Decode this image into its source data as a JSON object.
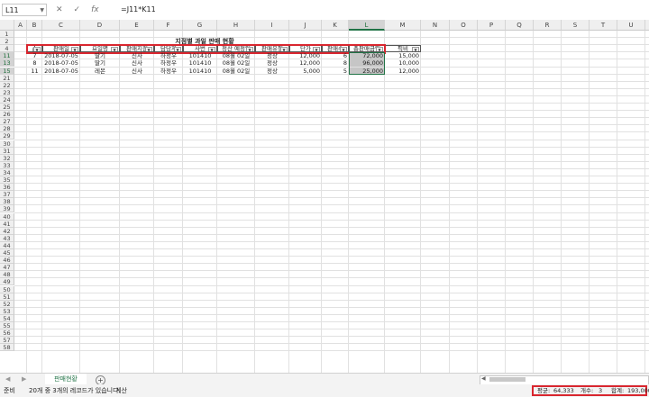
{
  "formula_bar": {
    "name_box": "L11",
    "formula": "=J11*K11",
    "cancel_icon": "✕",
    "enter_icon": "✓",
    "fx_icon": "fx"
  },
  "columns": [
    "A",
    "B",
    "C",
    "D",
    "E",
    "F",
    "G",
    "H",
    "I",
    "J",
    "K",
    "L",
    "M",
    "N",
    "O",
    "P",
    "Q",
    "R",
    "S",
    "T",
    "U",
    "V"
  ],
  "selected_column": "L",
  "rows": [
    "1",
    "2",
    "4",
    "11",
    "13",
    "15",
    "21",
    "22",
    "23",
    "24",
    "25",
    "26",
    "27",
    "28",
    "29",
    "30",
    "31",
    "32",
    "33",
    "34",
    "35",
    "36",
    "37",
    "38",
    "39",
    "40",
    "41",
    "42",
    "43",
    "44",
    "45",
    "46",
    "47",
    "48",
    "49",
    "50",
    "51",
    "52",
    "53",
    "54",
    "55",
    "56",
    "57",
    "58"
  ],
  "highlighted_rows": [
    "11",
    "13",
    "15"
  ],
  "sheet": {
    "title": "지점별 과일 판매 현황",
    "headers": [
      "순",
      "판매일",
      "요일명",
      "판매지점",
      "담당자",
      "사번",
      "정산 예정일",
      "판매유형",
      "단가",
      "판매수",
      "총판매금액",
      "픽비"
    ],
    "data_rows": [
      [
        "7",
        "2018-07-05",
        "딸기",
        "신사",
        "하정우",
        "101410",
        "08월 02일",
        "정상",
        "12,000",
        "6",
        "72,000",
        "15,000"
      ],
      [
        "8",
        "2018-07-05",
        "딸기",
        "신사",
        "하정우",
        "101410",
        "08월 02일",
        "정상",
        "12,000",
        "8",
        "96,000",
        "10,000"
      ],
      [
        "11",
        "2018-07-05",
        "레몬",
        "신사",
        "하정우",
        "101410",
        "08월 02일",
        "정상",
        "5,000",
        "5",
        "25,000",
        "12,000"
      ]
    ]
  },
  "sheet_tab": "판매현황",
  "add_sheet": "+",
  "status": {
    "ready": "준비",
    "filter_msg": "20개 중 3개의 레코드가 있습니다.",
    "calc": "계산",
    "average_label": "평균:",
    "average_value": "64,333",
    "count_label": "개수:",
    "count_value": "3",
    "sum_label": "합계:",
    "sum_value": "193,000"
  }
}
